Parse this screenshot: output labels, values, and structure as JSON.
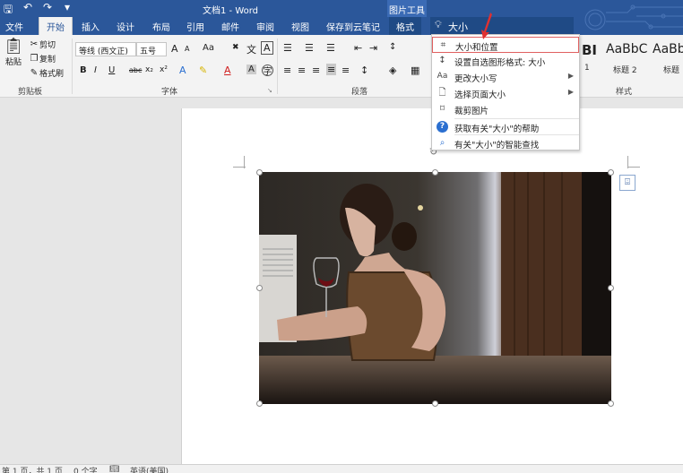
{
  "titlebar": {
    "title": "文档1 - Word",
    "context_tools": "图片工具",
    "qat": [
      "save-icon",
      "undo-icon",
      "redo-icon",
      "customize-icon"
    ]
  },
  "tabs": [
    {
      "label": "文件",
      "active": false
    },
    {
      "label": "开始",
      "active": true
    },
    {
      "label": "插入",
      "active": false
    },
    {
      "label": "设计",
      "active": false
    },
    {
      "label": "布局",
      "active": false
    },
    {
      "label": "引用",
      "active": false
    },
    {
      "label": "邮件",
      "active": false
    },
    {
      "label": "审阅",
      "active": false
    },
    {
      "label": "视图",
      "active": false
    },
    {
      "label": "保存到云笔记",
      "active": false
    },
    {
      "label": "格式",
      "active": false
    }
  ],
  "tellme": {
    "value": "大小"
  },
  "clipboard": {
    "paste": "粘贴",
    "cut": "剪切",
    "copy": "复制",
    "format_painter": "格式刷",
    "group_label": "剪贴板"
  },
  "font": {
    "font_name": "等线 (西文正)",
    "font_size": "五号",
    "grow": "A",
    "shrink": "A",
    "change_case": "Aa",
    "wen": "文",
    "bold": "B",
    "italic": "I",
    "underline": "U",
    "strike": "abc",
    "subscript": "x₂",
    "superscript": "x²",
    "group_label": "字体"
  },
  "paragraph": {
    "group_label": "段落"
  },
  "styles": {
    "items": [
      {
        "preview": "BI",
        "name": "1"
      },
      {
        "preview": "AaBbC",
        "name": "标题 2"
      },
      {
        "preview": "AaBb",
        "name": "标题"
      }
    ],
    "group_label": "样式"
  },
  "menu": {
    "items": [
      {
        "label": "大小和位置",
        "icon": "size-position-icon",
        "arrow": false,
        "highlighted": true
      },
      {
        "label": "设置自选图形格式: 大小",
        "icon": "format-shape-icon",
        "arrow": false,
        "highlighted": false
      },
      {
        "label": "更改大小写",
        "icon": "change-case-icon",
        "arrow": true,
        "highlighted": false
      },
      {
        "label": "选择页面大小",
        "icon": "page-size-icon",
        "arrow": true,
        "highlighted": false
      },
      {
        "label": "裁剪图片",
        "icon": "crop-icon",
        "arrow": false,
        "highlighted": false
      },
      {
        "label": "获取有关\"大小\"的帮助",
        "icon": "help-icon",
        "arrow": false,
        "highlighted": false
      },
      {
        "label": "有关\"大小\"的智能查找",
        "icon": "smart-lookup-icon",
        "arrow": false,
        "highlighted": false
      }
    ]
  },
  "statusbar": {
    "page": "第 1 页，共 1 页",
    "words": "0 个字",
    "language": "英语(美国)"
  },
  "colors": {
    "accent": "#2b579a",
    "menu_highlight_border": "#e06060",
    "red_arrow": "#e03030"
  }
}
